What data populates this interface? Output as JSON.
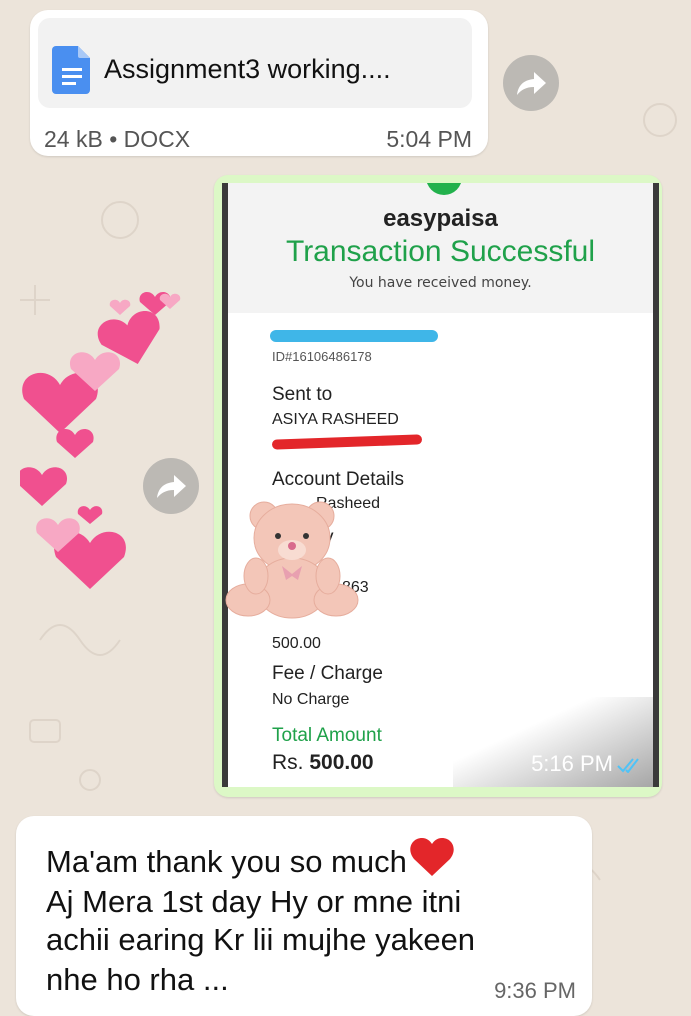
{
  "file_message": {
    "filename": "Assignment3 working....",
    "meta": "24 kB • DOCX",
    "time": "5:04 PM"
  },
  "receipt_message": {
    "brand": "easypaisa",
    "title": "Transaction Successful",
    "subtitle": "You have received money.",
    "transaction_id": "ID#16106486178",
    "sent_to_label": "Sent to",
    "sent_to_name": "ASIYA RASHEED",
    "account_details_label": "Account Details",
    "account_name_partial": "Rasheed",
    "partial_y": "y",
    "partial_number": "863",
    "amount_value": "500.00",
    "fee_label": "Fee / Charge",
    "fee_value": "No Charge",
    "total_label": "Total Amount",
    "total_prefix": "Rs.",
    "total_value": "500.00",
    "time": "5:16 PM",
    "colors": {
      "accent": "#1fa14a",
      "bubble": "#dcf8c6",
      "tick": "#4fc3f7"
    }
  },
  "reply_message": {
    "line1": "Ma'am thank you so much",
    "line2": "Aj Mera 1st day Hy or mne itni",
    "line3": "achii earing Kr lii mujhe yakeen",
    "line4": "nhe ho rha ...",
    "time": "9:36 PM"
  },
  "icons": [
    "document-icon",
    "forward-icon",
    "heart-emoji-icon",
    "teddy-bear-sticker",
    "read-receipt-icon"
  ]
}
